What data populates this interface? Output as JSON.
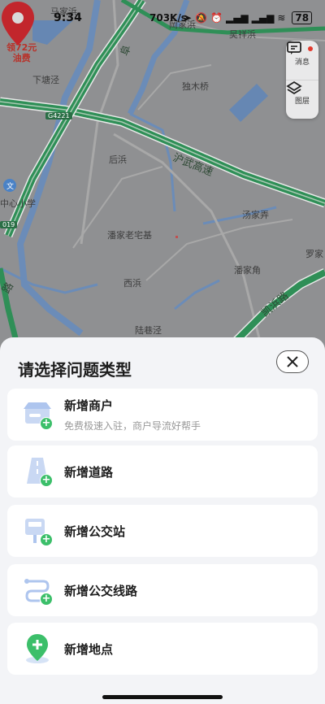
{
  "status_bar": {
    "time": "9:34",
    "net_speed": "703K/s",
    "battery": "78"
  },
  "map": {
    "labels": {
      "mazhibin": "马家浜",
      "wujiabang": "吴祥浜",
      "gangjia": "岡家浜",
      "xiatangjing": "下塘泾",
      "dumuqiao": "独木桥",
      "houbang": "后浜",
      "zhongxin_school": "中心小学",
      "tangjianong": "汤家弄",
      "panjialaozhai": "潘家老宅基",
      "luojia": "罗家",
      "panjiajiao": "潘家角",
      "xibang": "西浜",
      "luxiangjing": "陆巷泾",
      "road_fu": "阜",
      "road_huwu": "沪武高速",
      "road_kaibin": "凯浜路",
      "road_lu": "路",
      "shield_g4221": "G4221",
      "shield_019": "019",
      "promo": "领72元\n油费"
    },
    "controls": {
      "message": "消息",
      "layers": "图层"
    },
    "colors": {
      "highway": "#2f8f57",
      "river": "#5f86b8",
      "land": "#8f9092"
    }
  },
  "sheet": {
    "title": "请选择问题类型",
    "options": [
      {
        "title": "新增商户",
        "subtitle": "免费极速入驻，商户导流好帮手",
        "icon": "store-icon"
      },
      {
        "title": "新增道路",
        "icon": "road-icon"
      },
      {
        "title": "新增公交站",
        "icon": "bus-stop-icon"
      },
      {
        "title": "新增公交线路",
        "icon": "bus-route-icon"
      },
      {
        "title": "新增地点",
        "icon": "location-pin-icon"
      }
    ]
  }
}
